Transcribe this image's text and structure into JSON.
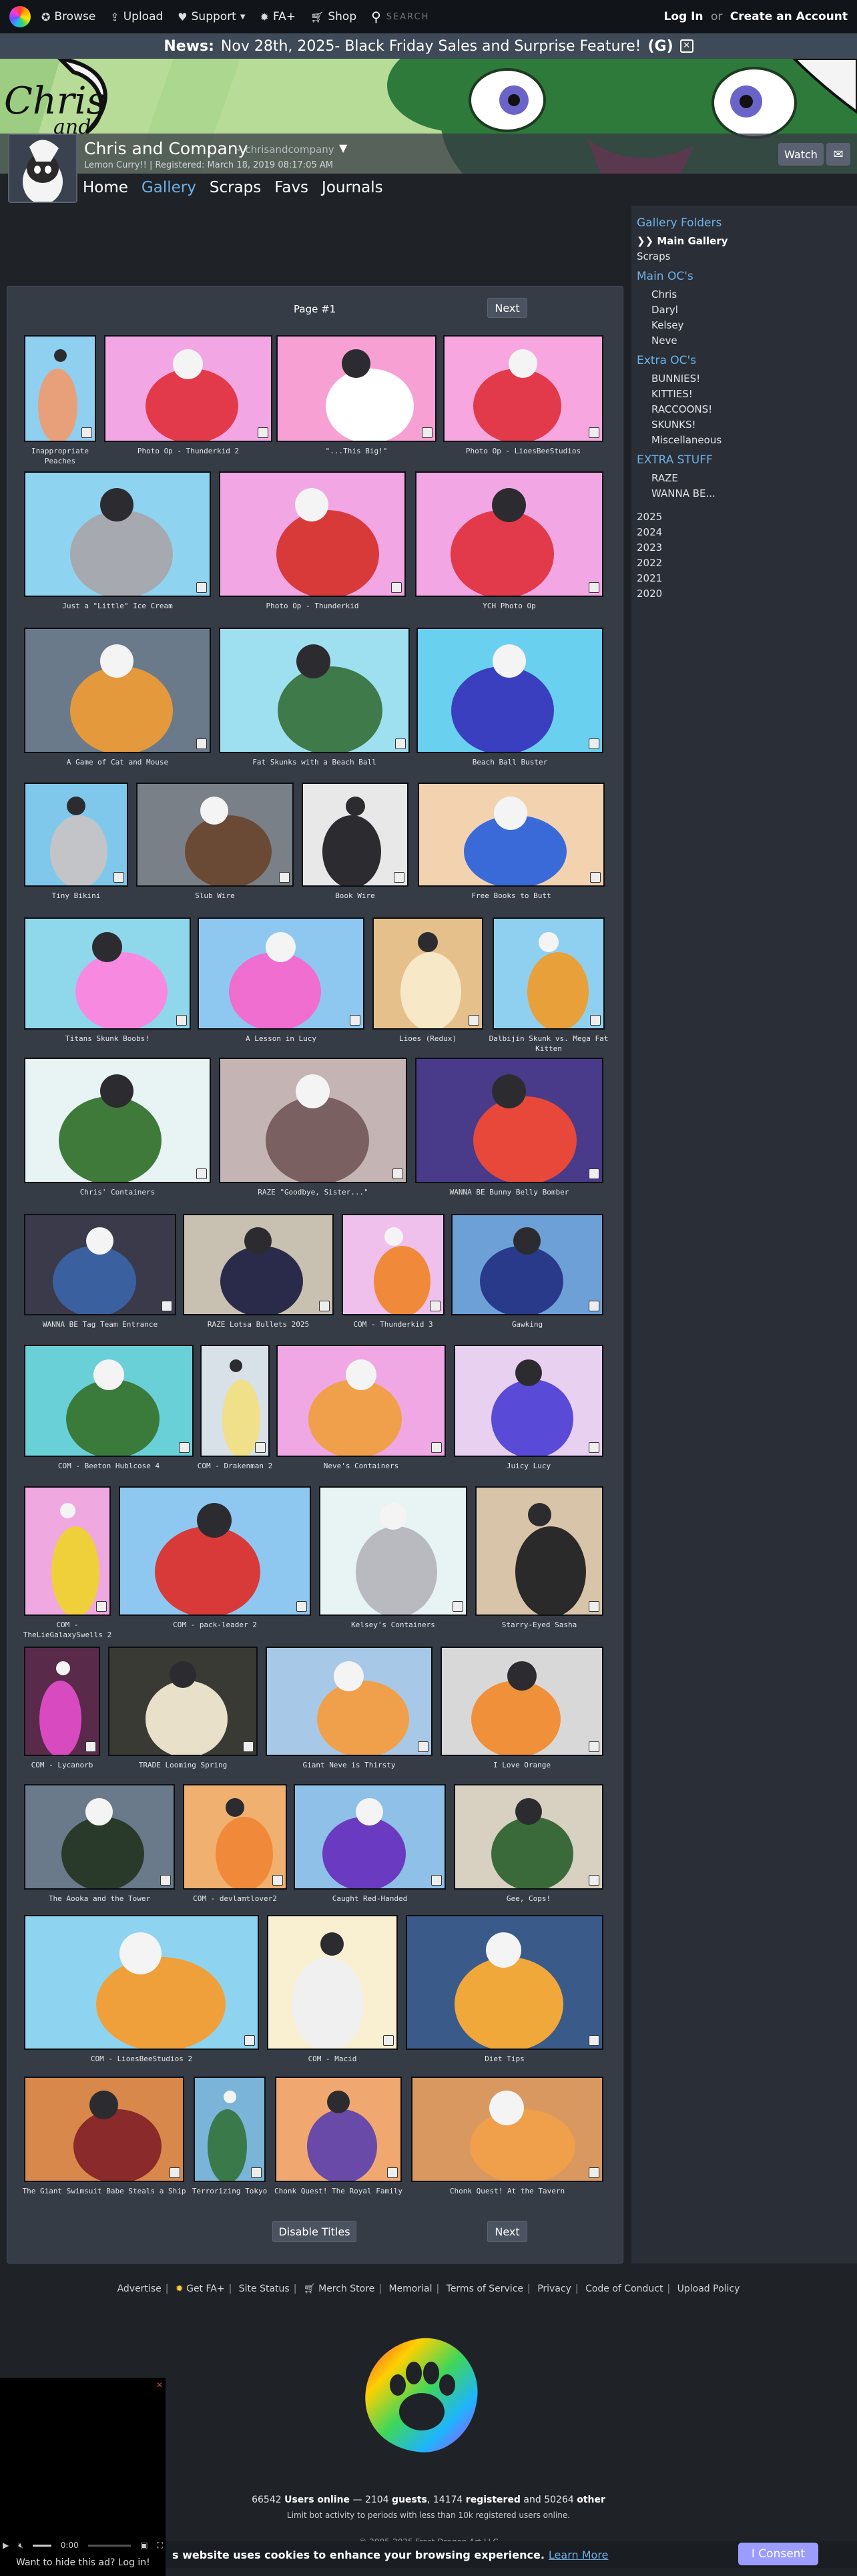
{
  "topnav": {
    "browse": "Browse",
    "upload": "Upload",
    "support": "Support",
    "fa_plus": "FA+",
    "shop": "Shop",
    "search_placeholder": "SEARCH",
    "login": "Log In",
    "or": "or",
    "create_account": "Create an Account"
  },
  "news": {
    "label": "News:",
    "text": "Nov 28th, 2025- Black Friday Sales and Surprise Feature!",
    "shortcut": "(G)"
  },
  "banner": {
    "logo_text": "Chris",
    "logo_text2": "and",
    "username": "Chris and Company",
    "handle": "~ chrisandcompany",
    "meta": "Lemon Curry!! | Registered: March 18, 2019 08:17:05 AM",
    "watch": "Watch"
  },
  "profile_tabs": [
    "Home",
    "Gallery",
    "Scraps",
    "Favs",
    "Journals"
  ],
  "pagination": {
    "page_label": "Page #1",
    "next": "Next",
    "disable_titles": "Disable Titles"
  },
  "gallery": [
    {
      "title": "Inappropriate Peaches",
      "bg": "#8fd0f0",
      "fig": "#e8a07a"
    },
    {
      "title": "Photo Op - Thunderkid 2",
      "bg": "#f3a6e4",
      "fig": "#e23a4a"
    },
    {
      "title": "\"...This Big!\"",
      "bg": "#f7a0d4",
      "fig": "#ffffff"
    },
    {
      "title": "Photo Op - LioesBeeStudios",
      "bg": "#f7a6e0",
      "fig": "#e23a4a"
    },
    {
      "title": "Just a \"Little\" Ice Cream",
      "bg": "#8ed4f0",
      "fig": "#a7a9b0"
    },
    {
      "title": "Photo Op - Thunderkid",
      "bg": "#f3a6e4",
      "fig": "#d83a3a"
    },
    {
      "title": "YCH Photo Op",
      "bg": "#f3a6e4",
      "fig": "#e23a4a"
    },
    {
      "title": "A Game of Cat and Mouse",
      "bg": "#6b7a8a",
      "fig": "#e49a3c"
    },
    {
      "title": "Fat Skunks with a Beach Ball",
      "bg": "#9fe0f0",
      "fig": "#3f7a4a"
    },
    {
      "title": "Beach Ball Buster",
      "bg": "#6ad0f0",
      "fig": "#3a3fc0"
    },
    {
      "title": "Tiny Bikini",
      "bg": "#7fc8ec",
      "fig": "#c2c4c8"
    },
    {
      "title": "Slub Wire",
      "bg": "#7a8088",
      "fig": "#6a4a34"
    },
    {
      "title": "Book Wire",
      "bg": "#e8e8e8",
      "fig": "#2c2c30"
    },
    {
      "title": "Free Books to Butt",
      "bg": "#f3d2b0",
      "fig": "#3a6ad8"
    },
    {
      "title": "Titans Skunk Boobs!",
      "bg": "#8fd8ec",
      "fig": "#f78ae0"
    },
    {
      "title": "A Lesson in Lucy",
      "bg": "#8ec8f0",
      "fig": "#f06ed0"
    },
    {
      "title": "Lioes (Redux)",
      "bg": "#e6c08a",
      "fig": "#f7e8c8"
    },
    {
      "title": "Dalbijin Skunk vs. Mega Fat Kitten",
      "bg": "#8fd0f0",
      "fig": "#e8a03a"
    },
    {
      "title": "Chris' Containers",
      "bg": "#e8f4f4",
      "fig": "#3f7a3a"
    },
    {
      "title": "RAZE \"Goodbye, Sister...\"",
      "bg": "#c4b4b4",
      "fig": "#7a6060"
    },
    {
      "title": "WANNA BE Bunny Belly Bomber",
      "bg": "#4a3a8a",
      "fig": "#e8483a"
    },
    {
      "title": "WANNA BE Tag Team Entrance",
      "bg": "#3a3a4a",
      "fig": "#3a60a0"
    },
    {
      "title": "RAZE Lotsa Bullets 2025",
      "bg": "#c8c0b0",
      "fig": "#2a2a4a"
    },
    {
      "title": "COM - Thunderkid 3",
      "bg": "#f0c0ec",
      "fig": "#f08a3a"
    },
    {
      "title": "Gawking",
      "bg": "#6ea0d8",
      "fig": "#2a3a8a"
    },
    {
      "title": "COM - Beeton Hublcose 4",
      "bg": "#6ad0d8",
      "fig": "#3a7a3a"
    },
    {
      "title": "COM - Drakenman 2",
      "bg": "#d8e0e8",
      "fig": "#f0e08a"
    },
    {
      "title": "Neve's Containers",
      "bg": "#f0a8e4",
      "fig": "#f0a04a"
    },
    {
      "title": "Juicy Lucy",
      "bg": "#e8d0f0",
      "fig": "#5a4ad8"
    },
    {
      "title": "COM - TheLieGalaxySwells 2",
      "bg": "#f0a8e0",
      "fig": "#f0d03a"
    },
    {
      "title": "COM - pack-leader 2",
      "bg": "#8ec8f0",
      "fig": "#d83a3a"
    },
    {
      "title": "Kelsey's Containers",
      "bg": "#e8f4f4",
      "fig": "#b8bac0"
    },
    {
      "title": "Starry-Eyed Sasha",
      "bg": "#d8c4a8",
      "fig": "#2a2a2a"
    },
    {
      "title": "COM - Lycanorb",
      "bg": "#5a2a4a",
      "fig": "#d84ac0"
    },
    {
      "title": "TRADE Looming Spring",
      "bg": "#3a3a34",
      "fig": "#e8e0c8"
    },
    {
      "title": "Giant Neve is Thirsty",
      "bg": "#a8c8e8",
      "fig": "#f0a04a"
    },
    {
      "title": "I Love Orange",
      "bg": "#d8d8d8",
      "fig": "#f0903a"
    },
    {
      "title": "The Aooka and the Tower",
      "bg": "#6a7a8a",
      "fig": "#2a3a2a"
    },
    {
      "title": "COM - devlamtlover2",
      "bg": "#f0b070",
      "fig": "#f08a3a"
    },
    {
      "title": "Caught Red-Handed",
      "bg": "#8ec0e8",
      "fig": "#6a3ac0"
    },
    {
      "title": "Gee, Cops!",
      "bg": "#d8d0c0",
      "fig": "#3a6a3a"
    },
    {
      "title": "COM - LioesBeeStudios 2",
      "bg": "#8ed4f0",
      "fig": "#f0a03a"
    },
    {
      "title": "COM - Macid",
      "bg": "#f8f0d0",
      "fig": "#f0f0f0"
    },
    {
      "title": "Diet Tips",
      "bg": "#3a5a8a",
      "fig": "#f0a83a"
    },
    {
      "title": "The Giant Swimsuit Babe Steals a Ship",
      "bg": "#d8884a",
      "fig": "#8a2a2a"
    },
    {
      "title": "Terrorizing Tokyo",
      "bg": "#7ab4d8",
      "fig": "#3a7a4a"
    },
    {
      "title": "Chonk Quest! The Royal Family",
      "bg": "#f0a870",
      "fig": "#6a4aa8"
    },
    {
      "title": "Chonk Quest! At the Tavern",
      "bg": "#d89860",
      "fig": "#f0a04a"
    }
  ],
  "sidebar": {
    "gallery_folders": "Gallery Folders",
    "main_gallery": "Main Gallery",
    "scraps": "Scraps",
    "main_ocs": "Main OC's",
    "main_oc_items": [
      "Chris",
      "Daryl",
      "Kelsey",
      "Neve"
    ],
    "extra_ocs": "Extra OC's",
    "extra_oc_items": [
      "BUNNIES!",
      "KITTIES!",
      "RACCOONS!",
      "SKUNKS!",
      "Miscellaneous"
    ],
    "extra_stuff": "EXTRA STUFF",
    "extra_stuff_items": [
      "RAZE",
      "WANNA BE..."
    ],
    "years": [
      "2025",
      "2024",
      "2023",
      "2022",
      "2021",
      "2020"
    ]
  },
  "footer": {
    "links": [
      "Advertise",
      "Get FA+",
      "Site Status",
      "Merch Store",
      "Memorial",
      "Terms of Service",
      "Privacy",
      "Code of Conduct",
      "Upload Policy"
    ],
    "users_online": "66542",
    "users_online_label": "Users online",
    "guests": "2104",
    "guests_label": "guests",
    "registered": "14174",
    "registered_label": "registered",
    "other": "50264",
    "other_label": "other",
    "note": "Limit bot activity to periods with less than 10k registered users online.",
    "copyright": "© 2005-2025 Frost Dragon Art LLC"
  },
  "ad": {
    "time": "0:00",
    "hint": "Want to hide this ad? Log in!"
  },
  "cookie": {
    "text": "s website uses cookies to enhance your browsing experience.",
    "learn_more": "Learn More",
    "consent": "I Consent"
  },
  "colors": {
    "link": "#6fb1e6",
    "panel": "#363c46",
    "page_bg": "#1f2227",
    "consent_btn": "#9c9cff"
  }
}
